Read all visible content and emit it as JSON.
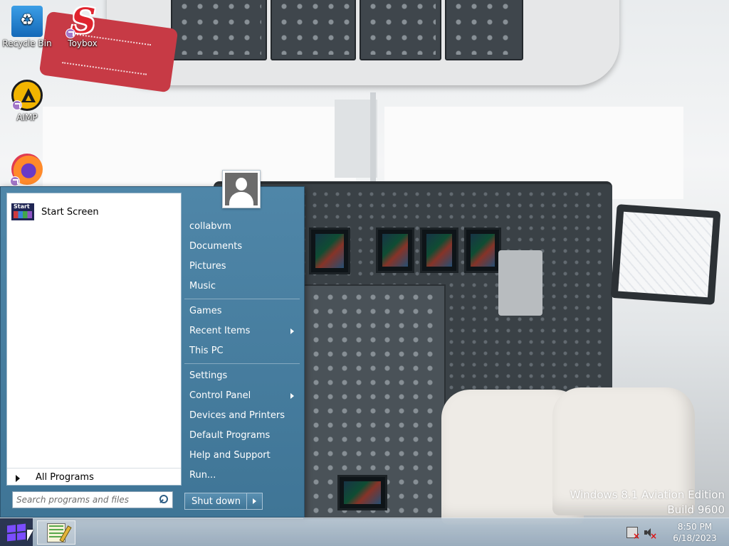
{
  "desktop": {
    "icons": [
      {
        "label": "Recycle Bin",
        "icon": "recycle-bin-icon"
      },
      {
        "label": "Toybox",
        "icon": "toybox-icon"
      },
      {
        "label": "AIMP",
        "icon": "aimp-icon"
      },
      {
        "label": "",
        "icon": "firefox-icon"
      }
    ],
    "wallpaper": {
      "edition_line": "Windows 8.1 Aviation Edition",
      "build_line": "Build 9600"
    }
  },
  "start_menu": {
    "pinned": [
      {
        "label": "Start Screen",
        "icon": "start-screen-icon"
      }
    ],
    "all_programs_label": "All Programs",
    "search_placeholder": "Search programs and files",
    "user_tile_icon": "user-avatar-icon",
    "right_items": [
      {
        "label": "collabvm"
      },
      {
        "label": "Documents"
      },
      {
        "label": "Pictures"
      },
      {
        "label": "Music"
      },
      {
        "label": "Games"
      },
      {
        "label": "Recent Items",
        "submenu": true
      },
      {
        "label": "This PC"
      },
      {
        "label": "Settings"
      },
      {
        "label": "Control Panel",
        "submenu": true
      },
      {
        "label": "Devices and Printers"
      },
      {
        "label": "Default Programs"
      },
      {
        "label": "Help and Support"
      },
      {
        "label": "Run..."
      }
    ],
    "shutdown_label": "Shut down"
  },
  "taskbar": {
    "start_icon": "windows-logo-icon",
    "pinned_apps": [
      {
        "icon": "notepad-plus-plus-icon"
      }
    ],
    "tray": {
      "network_icon": "network-disconnected-icon",
      "volume_icon": "volume-muted-icon",
      "time": "8:50 PM",
      "date": "6/18/2023"
    }
  },
  "colors": {
    "start_menu_blue": "#4f86a8",
    "accent_purple": "#7b4dff"
  }
}
